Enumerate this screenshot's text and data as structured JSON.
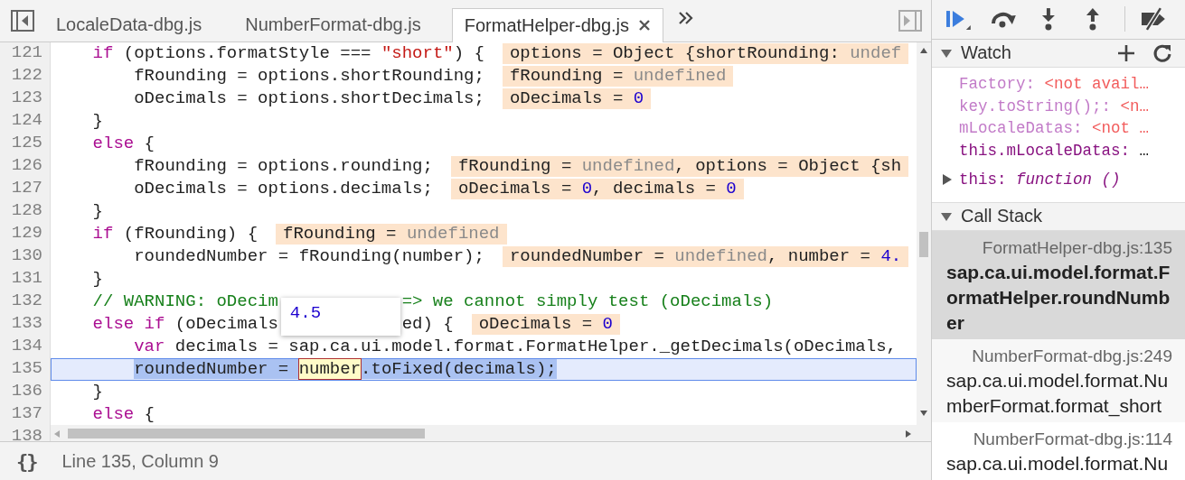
{
  "tabs": [
    {
      "label": "LocaleData-dbg.js",
      "selected": false
    },
    {
      "label": "NumberFormat-dbg.js",
      "selected": false
    },
    {
      "label": "FormatHelper-dbg.js",
      "selected": true
    }
  ],
  "editor": {
    "lines": [
      {
        "number": "121",
        "current": false,
        "code": [
          {
            "kind": "kw",
            "text": "    if"
          },
          {
            "kind": "plain",
            "text": " (options.formatStyle === "
          },
          {
            "kind": "str",
            "text": "\"short\""
          },
          {
            "kind": "plain",
            "text": ") {"
          }
        ],
        "value": [
          {
            "kind": "plain",
            "text": "options = Object {shortRounding: "
          },
          {
            "kind": "undef",
            "text": "undef"
          }
        ]
      },
      {
        "number": "122",
        "current": false,
        "code": [
          {
            "kind": "plain",
            "text": "        fRounding = options.shortRounding;"
          }
        ],
        "value": [
          {
            "kind": "plain",
            "text": "fRounding = "
          },
          {
            "kind": "undef",
            "text": "undefined"
          }
        ]
      },
      {
        "number": "123",
        "current": false,
        "code": [
          {
            "kind": "plain",
            "text": "        oDecimals = options.shortDecimals;"
          }
        ],
        "value": [
          {
            "kind": "plain",
            "text": "oDecimals = "
          },
          {
            "kind": "num",
            "text": "0"
          }
        ]
      },
      {
        "number": "124",
        "current": false,
        "code": [
          {
            "kind": "plain",
            "text": "    }"
          }
        ]
      },
      {
        "number": "125",
        "current": false,
        "code": [
          {
            "kind": "kw",
            "text": "    else"
          },
          {
            "kind": "plain",
            "text": " {"
          }
        ]
      },
      {
        "number": "126",
        "current": false,
        "code": [
          {
            "kind": "plain",
            "text": "        fRounding = options.rounding;"
          }
        ],
        "value": [
          {
            "kind": "plain",
            "text": "fRounding = "
          },
          {
            "kind": "undef",
            "text": "undefined"
          },
          {
            "kind": "plain",
            "text": ", options = Object {sh"
          }
        ]
      },
      {
        "number": "127",
        "current": false,
        "code": [
          {
            "kind": "plain",
            "text": "        oDecimals = options.decimals;"
          }
        ],
        "value": [
          {
            "kind": "plain",
            "text": "oDecimals = "
          },
          {
            "kind": "num",
            "text": "0"
          },
          {
            "kind": "plain",
            "text": ", decimals = "
          },
          {
            "kind": "num",
            "text": "0"
          }
        ]
      },
      {
        "number": "128",
        "current": false,
        "code": [
          {
            "kind": "plain",
            "text": "    }"
          }
        ]
      },
      {
        "number": "129",
        "current": false,
        "code": [
          {
            "kind": "kw",
            "text": "    if"
          },
          {
            "kind": "plain",
            "text": " (fRounding) {"
          }
        ],
        "value": [
          {
            "kind": "plain",
            "text": "fRounding = "
          },
          {
            "kind": "undef",
            "text": "undefined"
          }
        ]
      },
      {
        "number": "130",
        "current": false,
        "code": [
          {
            "kind": "plain",
            "text": "        roundedNumber = fRounding(number);"
          }
        ],
        "value": [
          {
            "kind": "plain",
            "text": "roundedNumber = "
          },
          {
            "kind": "undef",
            "text": "undefined"
          },
          {
            "kind": "plain",
            "text": ", number = "
          },
          {
            "kind": "num",
            "text": "4."
          }
        ]
      },
      {
        "number": "131",
        "current": false,
        "code": [
          {
            "kind": "plain",
            "text": "    }"
          }
        ]
      },
      {
        "number": "132",
        "current": false,
        "code": [
          {
            "kind": "comment",
            "text": "    // WARNING: oDecim"
          }
        ],
        "code_after": [
          {
            "kind": "comment",
            "text": "=> we cannot simply test (oDecimals)"
          }
        ]
      },
      {
        "number": "133",
        "current": false,
        "code": [
          {
            "kind": "kw",
            "text": "    else if"
          },
          {
            "kind": "plain",
            "text": " (oDecimals"
          }
        ],
        "code_after": [
          {
            "kind": "plain",
            "text": "ed) {"
          }
        ],
        "value": [
          {
            "kind": "plain",
            "text": "oDecimals = "
          },
          {
            "kind": "num",
            "text": "0"
          }
        ]
      },
      {
        "number": "134",
        "current": false,
        "code": [
          {
            "kind": "kw",
            "text": "        var"
          },
          {
            "kind": "plain",
            "text": " decimals = sap.ca.ui.model.format.FormatHelper._getDecimals(oDecimals,"
          }
        ]
      },
      {
        "number": "135",
        "current": true,
        "code": [
          {
            "kind": "plain",
            "text": "        roundedNumber = "
          },
          {
            "kind": "hover",
            "text": "number"
          },
          {
            "kind": "plain",
            "text": ".toFixed(decimals);"
          }
        ]
      },
      {
        "number": "136",
        "current": false,
        "code": [
          {
            "kind": "plain",
            "text": "    }"
          }
        ]
      },
      {
        "number": "137",
        "current": false,
        "code": [
          {
            "kind": "kw",
            "text": "    else"
          },
          {
            "kind": "plain",
            "text": " {"
          }
        ]
      },
      {
        "number": "138"
      }
    ],
    "hover_tooltip": {
      "value": "4.5"
    }
  },
  "status_bar": {
    "format_button": "{}",
    "position": "Line 135, Column 9"
  },
  "watch": {
    "title": "Watch",
    "expanded": true,
    "items": [
      {
        "kind": "expression",
        "name": "Factory:",
        "value": "<not avail…",
        "available": false
      },
      {
        "kind": "expression",
        "name": "key.toString();:",
        "value": "<n…",
        "available": false
      },
      {
        "kind": "expression",
        "name": "mLocaleDatas:",
        "value": "<not …",
        "available": false
      },
      {
        "kind": "expression",
        "name": "this.mLocaleDatas:",
        "value": "…",
        "available": true
      },
      {
        "kind": "property",
        "name": "this:",
        "value": "function ()",
        "expanded": false
      }
    ]
  },
  "call_stack": {
    "title": "Call Stack",
    "expanded": true,
    "items": [
      {
        "file": "FormatHelper-dbg.js:135",
        "function": "sap.ca.ui.model.format.FormatHelper.roundNumber",
        "selected": true
      },
      {
        "file": "NumberFormat-dbg.js:249",
        "function": "sap.ca.ui.model.format.NumberFormat.format_short",
        "selected": false
      },
      {
        "file": "NumberFormat-dbg.js:114",
        "function": "sap.ca.ui.model.format.Nu",
        "selected": false
      }
    ]
  }
}
